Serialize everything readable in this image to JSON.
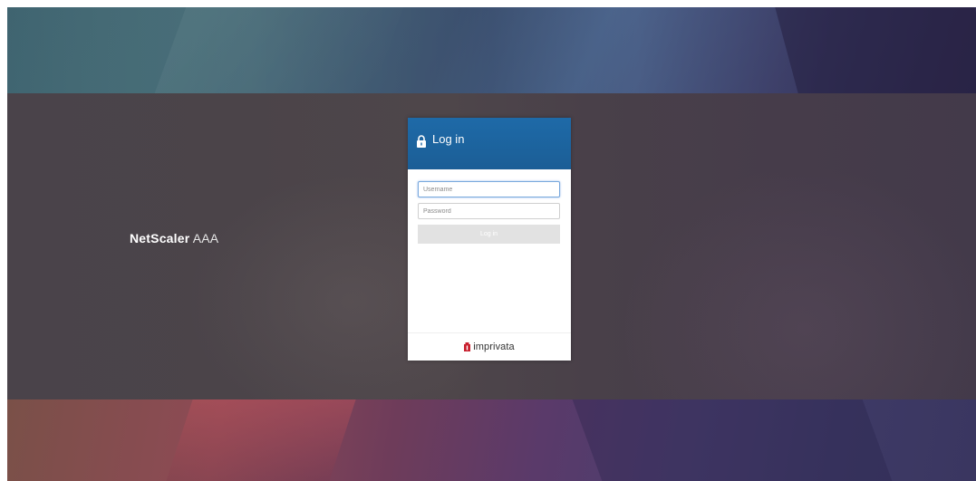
{
  "brand": {
    "name_bold": "NetScaler",
    "name_light": "AAA"
  },
  "login": {
    "title": "Log in",
    "username_placeholder": "Username",
    "password_placeholder": "Password",
    "submit_label": "Log in"
  },
  "footer": {
    "vendor": "imprivata",
    "vendor_icon": "imprivata-logo-icon",
    "vendor_color": "#c8202e"
  },
  "colors": {
    "header_blue": "#1e6aa8",
    "button_disabled": "#e2e2e2"
  },
  "icons": {
    "title_icon": "lock-icon"
  }
}
